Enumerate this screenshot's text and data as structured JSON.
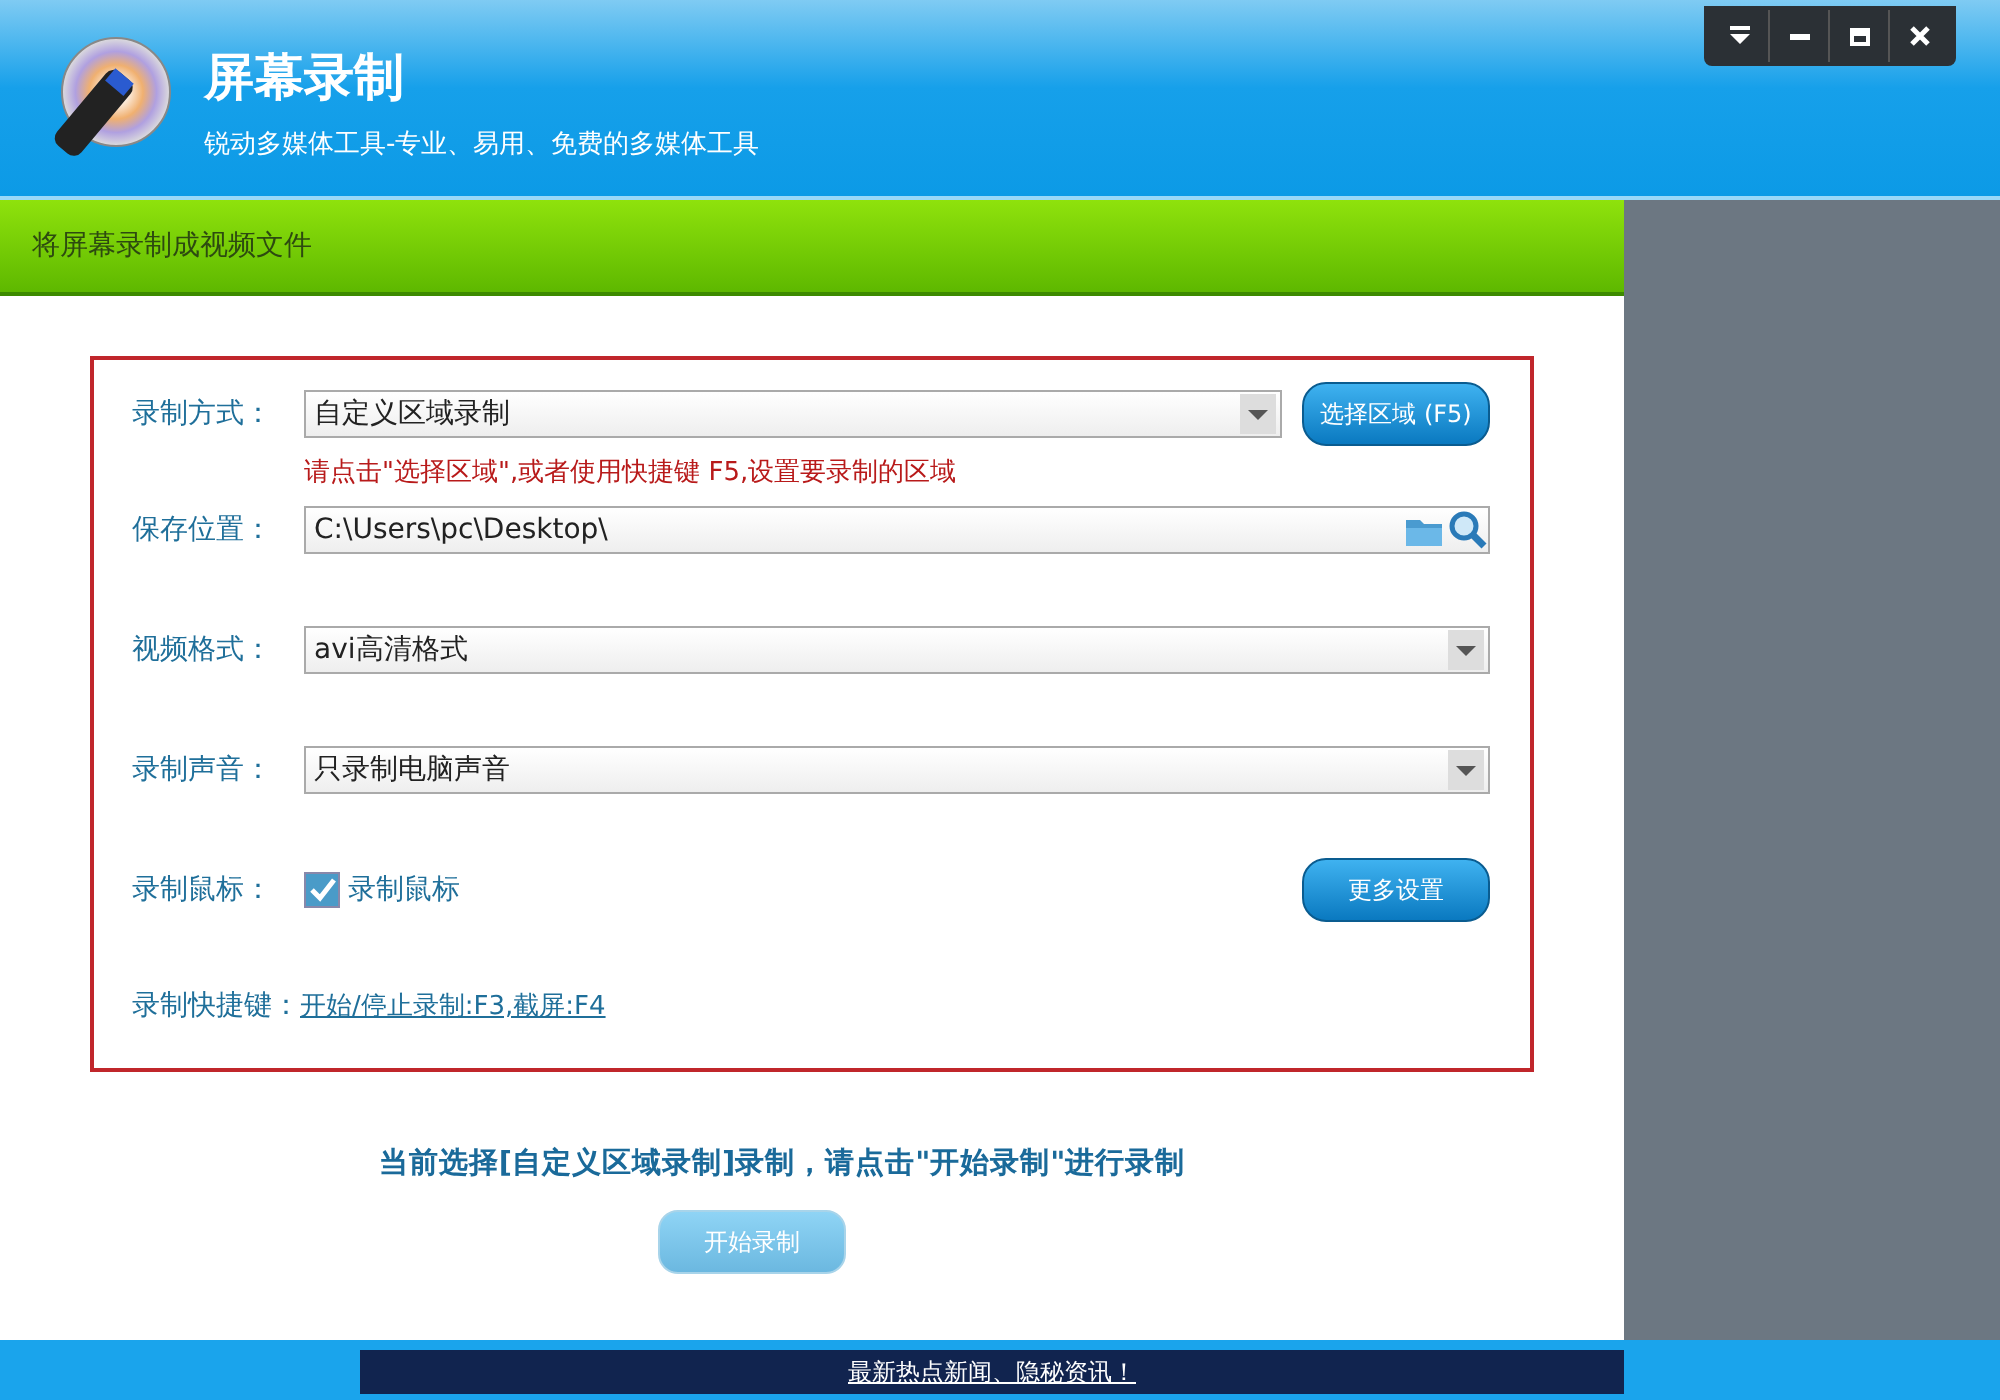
{
  "header": {
    "title": "屏幕录制",
    "subtitle": "锐动多媒体工具-专业、易用、免费的多媒体工具"
  },
  "window_controls": [
    {
      "kind": "menu"
    },
    {
      "kind": "minimize"
    },
    {
      "kind": "maximize"
    },
    {
      "kind": "close"
    }
  ],
  "section_bar": {
    "title": "将屏幕录制成视频文件"
  },
  "form": {
    "rows": [
      {
        "kind": "dropdown",
        "label": "录制方式：",
        "value": "自定义区域录制",
        "button": "选择区域 (F5)",
        "hint": "请点击\"选择区域\",或者使用快捷键 F5,设置要录制的区域"
      },
      {
        "kind": "path",
        "label": "保存位置：",
        "value": "C:\\Users\\pc\\Desktop\\"
      },
      {
        "kind": "dropdown",
        "label": "视频格式：",
        "value": "avi高清格式"
      },
      {
        "kind": "dropdown",
        "label": "录制声音：",
        "value": "只录制电脑声音"
      },
      {
        "kind": "checkbox",
        "label": "录制鼠标：",
        "option": "录制鼠标",
        "checked": true,
        "button": "更多设置"
      },
      {
        "kind": "link",
        "label": "录制快捷键：",
        "link": "开始/停止录制:F3,截屏:F4"
      }
    ]
  },
  "status_message": "当前选择[自定义区域录制]录制，请点击\"开始录制\"进行录制",
  "start_button": {
    "label": "开始录制",
    "disabled": true
  },
  "news_bar": {
    "text": "最新热点新闻、隐秘资讯！"
  }
}
